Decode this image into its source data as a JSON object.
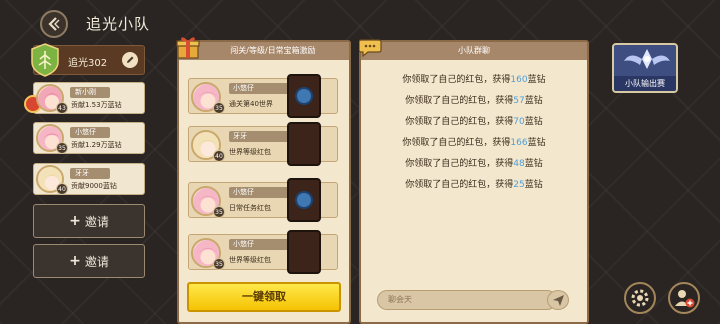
{
  "header": {
    "title": "追光小队"
  },
  "team": {
    "name": "追光302"
  },
  "members": [
    {
      "name": "新小刚",
      "contribution": "贡献1.53万蓝钻",
      "level": "43",
      "leader": true
    },
    {
      "name": "小悠仔",
      "contribution": "贡献1.29万蓝钻",
      "level": "35",
      "leader": false
    },
    {
      "name": "牙牙",
      "contribution": "贡献9000蓝钻",
      "level": "40",
      "leader": false
    }
  ],
  "invite_buttons": [
    {
      "label": "邀请"
    },
    {
      "label": "邀请"
    }
  ],
  "rewards": {
    "header": "闯关/等级/日常宝箱激励",
    "rows": [
      {
        "name": "小悠仔",
        "desc": "通关第40世界",
        "level": "35"
      },
      {
        "name": "牙牙",
        "desc": "世界等级红包",
        "level": "40"
      },
      {
        "name": "小悠仔",
        "desc": "日常任务红包",
        "level": "35"
      },
      {
        "name": "小悠仔",
        "desc": "世界等级红包",
        "level": "35"
      }
    ],
    "claim_all": "一键领取"
  },
  "chat": {
    "header": "小队群聊",
    "lines": [
      {
        "prefix": "你领取了自己的红包，获得",
        "amount": "160",
        "suffix": "蓝钻"
      },
      {
        "prefix": "你领取了自己的红包，获得",
        "amount": "57",
        "suffix": "蓝钻"
      },
      {
        "prefix": "你领取了自己的红包，获得",
        "amount": "70",
        "suffix": "蓝钻"
      },
      {
        "prefix": "你领取了自己的红包，获得",
        "amount": "166",
        "suffix": "蓝钻"
      },
      {
        "prefix": "你领取了自己的红包，获得",
        "amount": "48",
        "suffix": "蓝钻"
      },
      {
        "prefix": "你领取了自己的红包，获得",
        "amount": "25",
        "suffix": "蓝钻"
      }
    ],
    "input_placeholder": "聊会天"
  },
  "contest": {
    "label": "小队输出赛"
  },
  "icons": {
    "back": "back-arrow-icon",
    "edit": "pencil-icon",
    "gift": "gift-icon",
    "chat": "speech-bubble-icon",
    "send": "paper-plane-icon",
    "settings": "gear-icon",
    "add_member": "add-user-icon"
  },
  "colors": {
    "amount": "#4f9fd9",
    "claim_button": "#f5c203",
    "panel": "#f3e7cd"
  }
}
